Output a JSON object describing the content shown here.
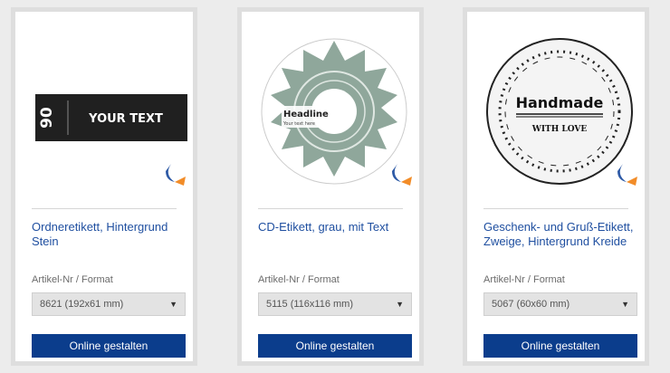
{
  "cards": [
    {
      "title": "Ordneretikett, Hintergrund Stein",
      "format_label": "Artikel-Nr / Format",
      "format_value": "8621 (192x61 mm)",
      "button_label": "Online gestalten",
      "preview": {
        "text_main": "YOUR TEXT",
        "text_side": "90"
      }
    },
    {
      "title": "CD-Etikett, grau, mit Text",
      "format_label": "Artikel-Nr / Format",
      "format_value": "5115 (116x116 mm)",
      "button_label": "Online gestalten",
      "preview": {
        "headline": "Headline",
        "sub": "Your text here"
      }
    },
    {
      "title": "Geschenk- und Gruß-Etikett, Zweige, Hintergrund Kreide",
      "format_label": "Artikel-Nr / Format",
      "format_value": "5067 (60x60 mm)",
      "button_label": "Online gestalten",
      "preview": {
        "line1": "Handmade",
        "line2": "WITH LOVE"
      }
    }
  ],
  "colors": {
    "link": "#1f4fa0",
    "button": "#0b3d8c",
    "card_border": "#dedede"
  }
}
